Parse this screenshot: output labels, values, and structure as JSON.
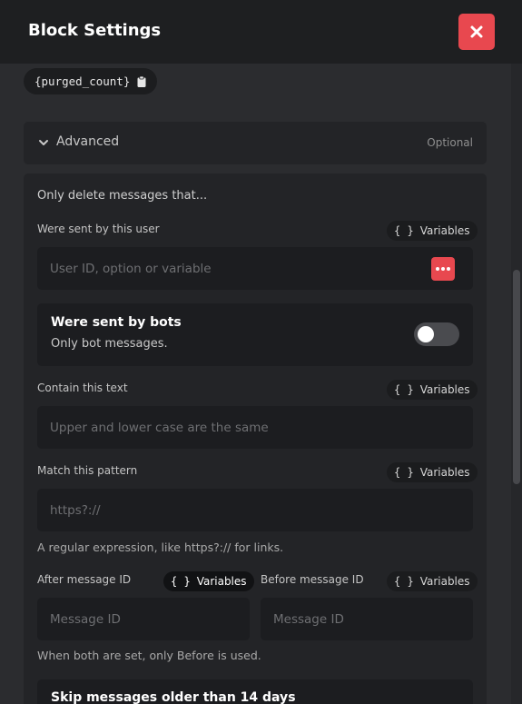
{
  "header": {
    "title": "Block Settings",
    "close_icon": "close-icon",
    "close_color": "#e8484f"
  },
  "variable_pill": {
    "text": "{purged_count}",
    "icon": "clipboard-icon"
  },
  "advanced": {
    "label": "Advanced",
    "badge": "Optional",
    "icon": "chevron-down-icon"
  },
  "panel": {
    "title": "Only delete messages that...",
    "variables_label": "Variables",
    "sent_by_user": {
      "label": "Were sent by this user",
      "placeholder": "User ID, option or variable",
      "menu_icon": "more-options-icon"
    },
    "sent_by_bots": {
      "title": "Were sent by bots",
      "subtitle": "Only bot messages.",
      "enabled": false
    },
    "contain_text": {
      "label": "Contain this text",
      "placeholder": "Upper and lower case are the same"
    },
    "match_pattern": {
      "label": "Match this pattern",
      "placeholder": "https?://",
      "help": "A regular expression, like https?:// for links."
    },
    "after_id": {
      "label": "After message ID",
      "placeholder": "Message ID"
    },
    "before_id": {
      "label": "Before message ID",
      "placeholder": "Message ID"
    },
    "ids_help": "When both are set, only Before is used.",
    "skip_old": {
      "title": "Skip messages older than 14 days"
    }
  },
  "colors": {
    "accent": "#e8484f",
    "background": "#2b2c2f",
    "header": "#1e1f21",
    "panel": "#232427",
    "input": "#1c1d20"
  }
}
